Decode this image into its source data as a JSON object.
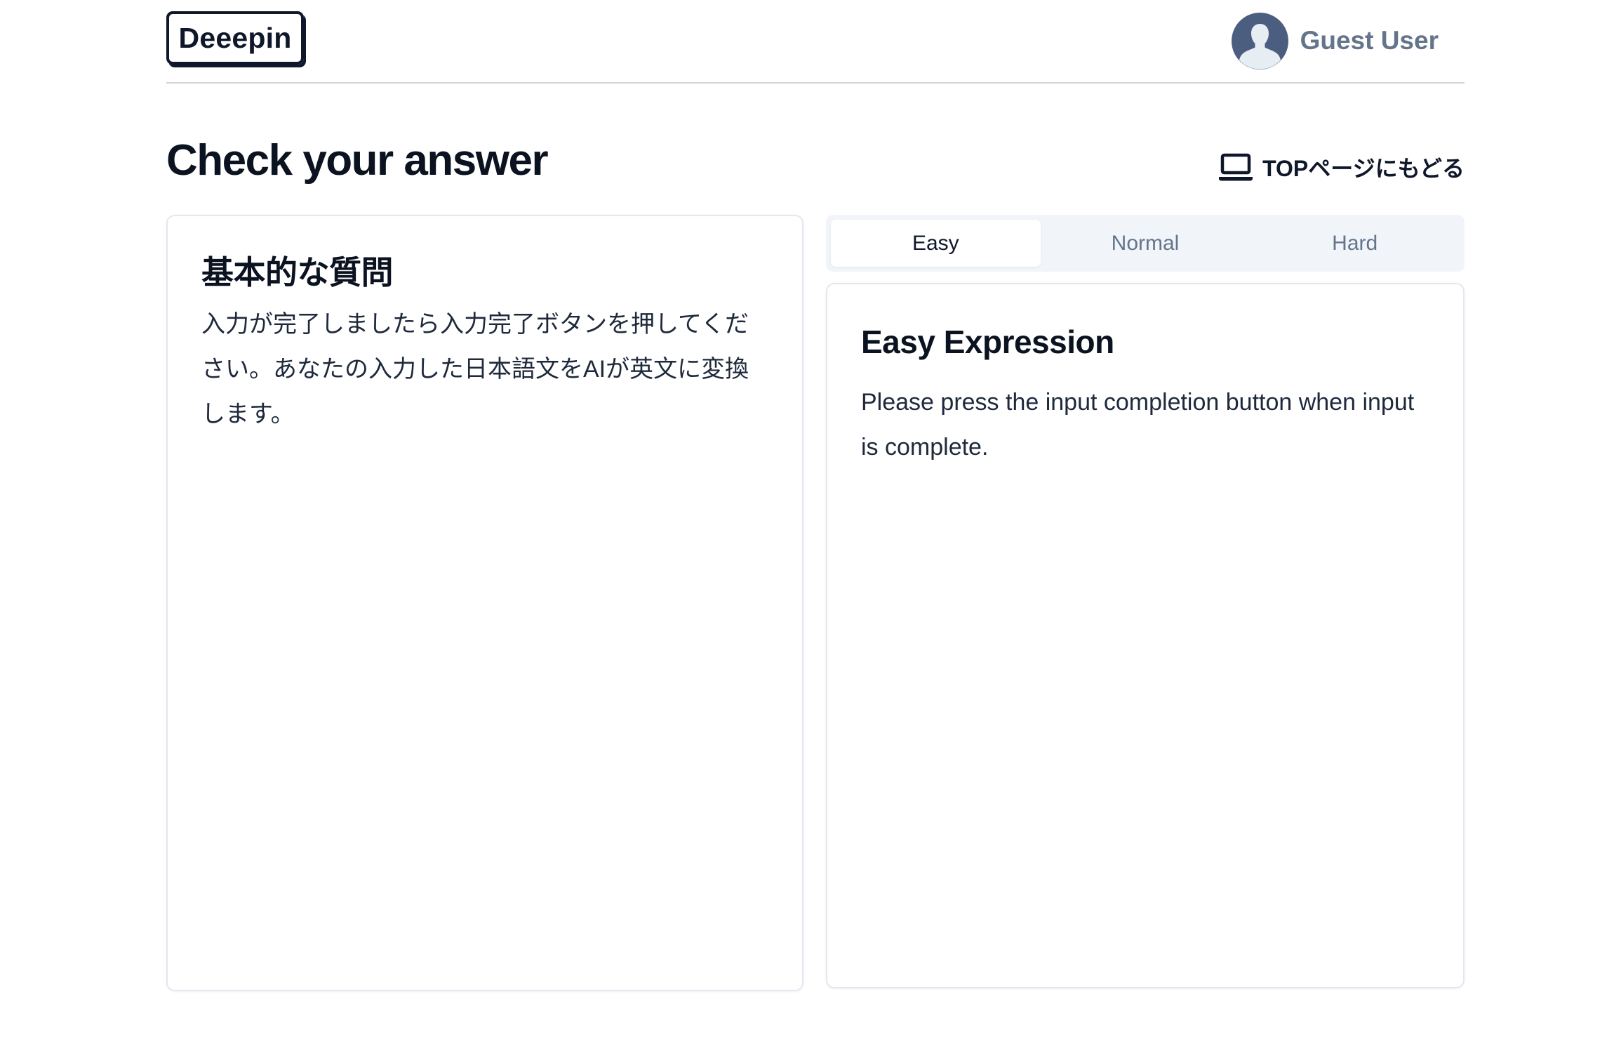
{
  "header": {
    "logo_text": "Deeepin",
    "user_name": "Guest User"
  },
  "main": {
    "title": "Check your answer",
    "back_link_label": "TOPページにもどる"
  },
  "question_card": {
    "heading": "基本的な質問",
    "body": "入力が完了しましたら入力完了ボタンを押してください。あなたの入力した日本語文をAIが英文に変換します。"
  },
  "tabs": [
    {
      "label": "Easy",
      "active": true
    },
    {
      "label": "Normal",
      "active": false
    },
    {
      "label": "Hard",
      "active": false
    }
  ],
  "answer_card": {
    "heading": "Easy Expression",
    "body": "Please press the input completion button when input is complete."
  },
  "colors": {
    "text_primary": "#0f172a",
    "text_muted": "#64748b",
    "avatar_bg": "#4b5e7f",
    "tabs_bg": "#f1f5f9",
    "card_border": "#e2e8f0"
  },
  "icons": {
    "back_link": "laptop-icon",
    "avatar": "user-silhouette-icon"
  }
}
